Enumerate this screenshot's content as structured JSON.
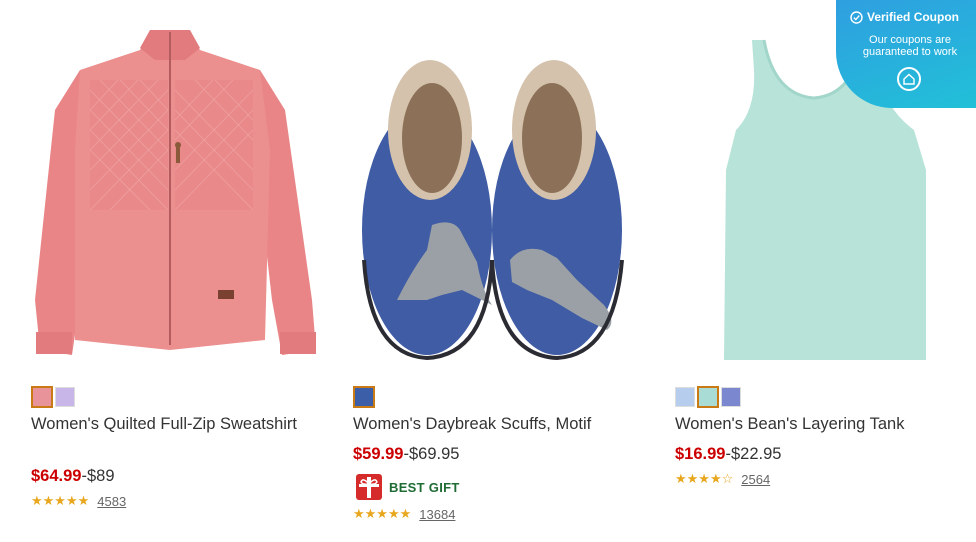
{
  "products": [
    {
      "name": "Women's Quilted Full-Zip Sweatshirt",
      "sale_price": "$64.99",
      "regular_price": "-$89",
      "rating_stars": "★★★★★",
      "rating_count": "4583",
      "swatches": [
        "#e8929a",
        "#c9b6e8"
      ]
    },
    {
      "name": "Women's Daybreak Scuffs, Motif",
      "sale_price": "$59.99",
      "regular_price": "-$69.95",
      "badge": "BEST GIFT",
      "rating_stars": "★★★★★",
      "rating_count": "13684",
      "swatches": [
        "#3c5ea8"
      ]
    },
    {
      "name": "Women's Bean's Layering Tank",
      "sale_price": "$16.99",
      "regular_price": "-$22.95",
      "rating_stars": "★★★★☆",
      "rating_count": "2564",
      "swatches": [
        "#b6cdee",
        "#a8dcd5",
        "#7b87cf"
      ]
    }
  ],
  "coupon": {
    "title": "Verified Coupon",
    "subtitle": "Our coupons are guaranteed to work"
  },
  "colors": {
    "sale": "#cc0000",
    "badge_text": "#1f6b34",
    "star": "#e8a71e",
    "coupon_bg": "#2aa8de"
  }
}
